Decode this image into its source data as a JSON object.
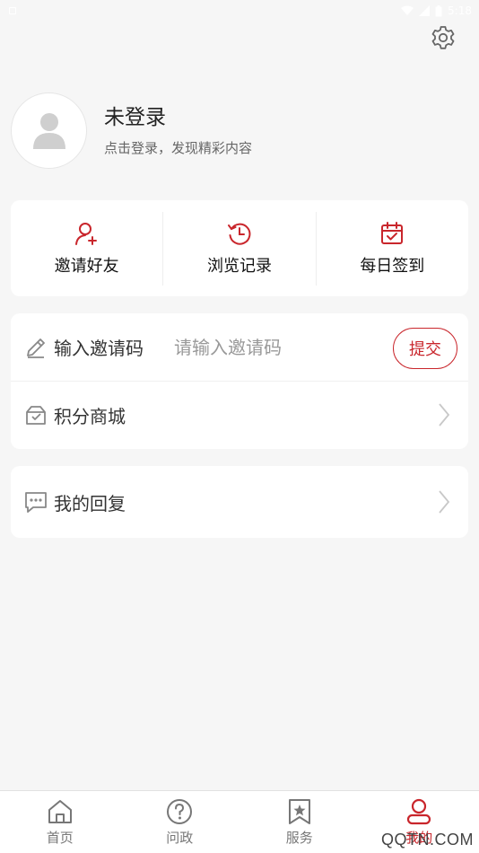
{
  "status_bar": {
    "time": "5:18"
  },
  "profile": {
    "name": "未登录",
    "subtitle": "点击登录，发现精彩内容"
  },
  "quick_actions": [
    {
      "label": "邀请好友",
      "icon": "add-user-icon"
    },
    {
      "label": "浏览记录",
      "icon": "history-icon"
    },
    {
      "label": "每日签到",
      "icon": "calendar-check-icon"
    }
  ],
  "menu": {
    "invite_code": {
      "label": "输入邀请码",
      "placeholder": "请输入邀请码",
      "submit_label": "提交"
    },
    "points_mall": {
      "label": "积分商城"
    },
    "my_replies": {
      "label": "我的回复"
    }
  },
  "tabbar": {
    "items": [
      {
        "label": "首页",
        "icon": "home-icon"
      },
      {
        "label": "问政",
        "icon": "question-icon"
      },
      {
        "label": "服务",
        "icon": "bookmark-star-icon"
      },
      {
        "label": "我的",
        "icon": "user-icon",
        "active": true
      }
    ]
  },
  "watermark": "QQTN.COM",
  "colors": {
    "accent": "#c9262c",
    "background": "#f6f6f6"
  }
}
